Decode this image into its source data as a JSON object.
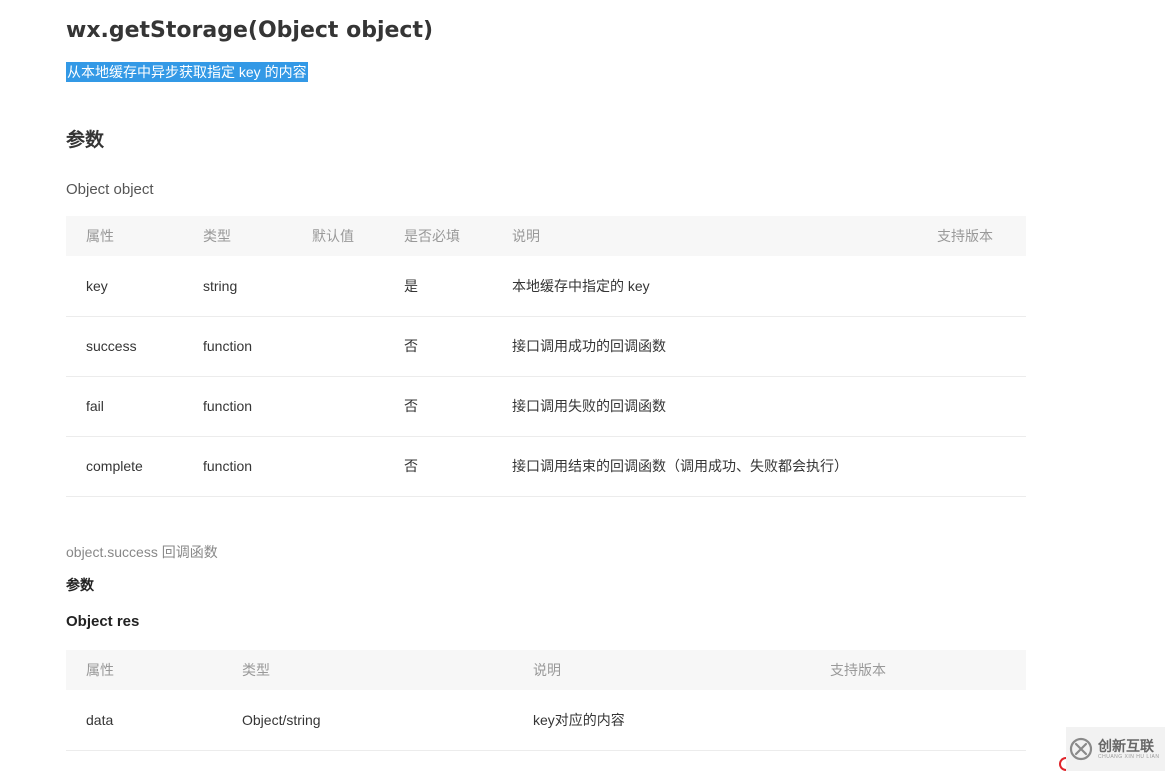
{
  "doc": {
    "title": "wx.getStorage(Object object)",
    "description": "从本地缓存中异步获取指定 key 的内容",
    "params_heading": "参数",
    "object_label": "Object object",
    "params_table": {
      "headers": [
        "属性",
        "类型",
        "默认值",
        "是否必填",
        "说明",
        "支持版本"
      ],
      "rows": [
        [
          "key",
          "string",
          "",
          "是",
          "本地缓存中指定的 key",
          ""
        ],
        [
          "success",
          "function",
          "",
          "否",
          "接口调用成功的回调函数",
          ""
        ],
        [
          "fail",
          "function",
          "",
          "否",
          "接口调用失败的回调函数",
          ""
        ],
        [
          "complete",
          "function",
          "",
          "否",
          "接口调用结束的回调函数（调用成功、失败都会执行）",
          ""
        ]
      ]
    },
    "callback_label": "object.success 回调函数",
    "callback_params_heading": "参数",
    "res_label": "Object res",
    "res_table": {
      "headers": [
        "属性",
        "类型",
        "说明",
        "支持版本"
      ],
      "rows": [
        [
          "data",
          "Object/string",
          "key对应的内容",
          ""
        ]
      ]
    }
  },
  "watermark": {
    "logo_icon": "chuangxin-logo-icon",
    "name": "创新互联",
    "subtitle": "CHUANG XIN HU LIAN"
  },
  "colors": {
    "selection": "#3399e6",
    "header_bg": "#f7f7f7",
    "divider": "#ececec"
  }
}
